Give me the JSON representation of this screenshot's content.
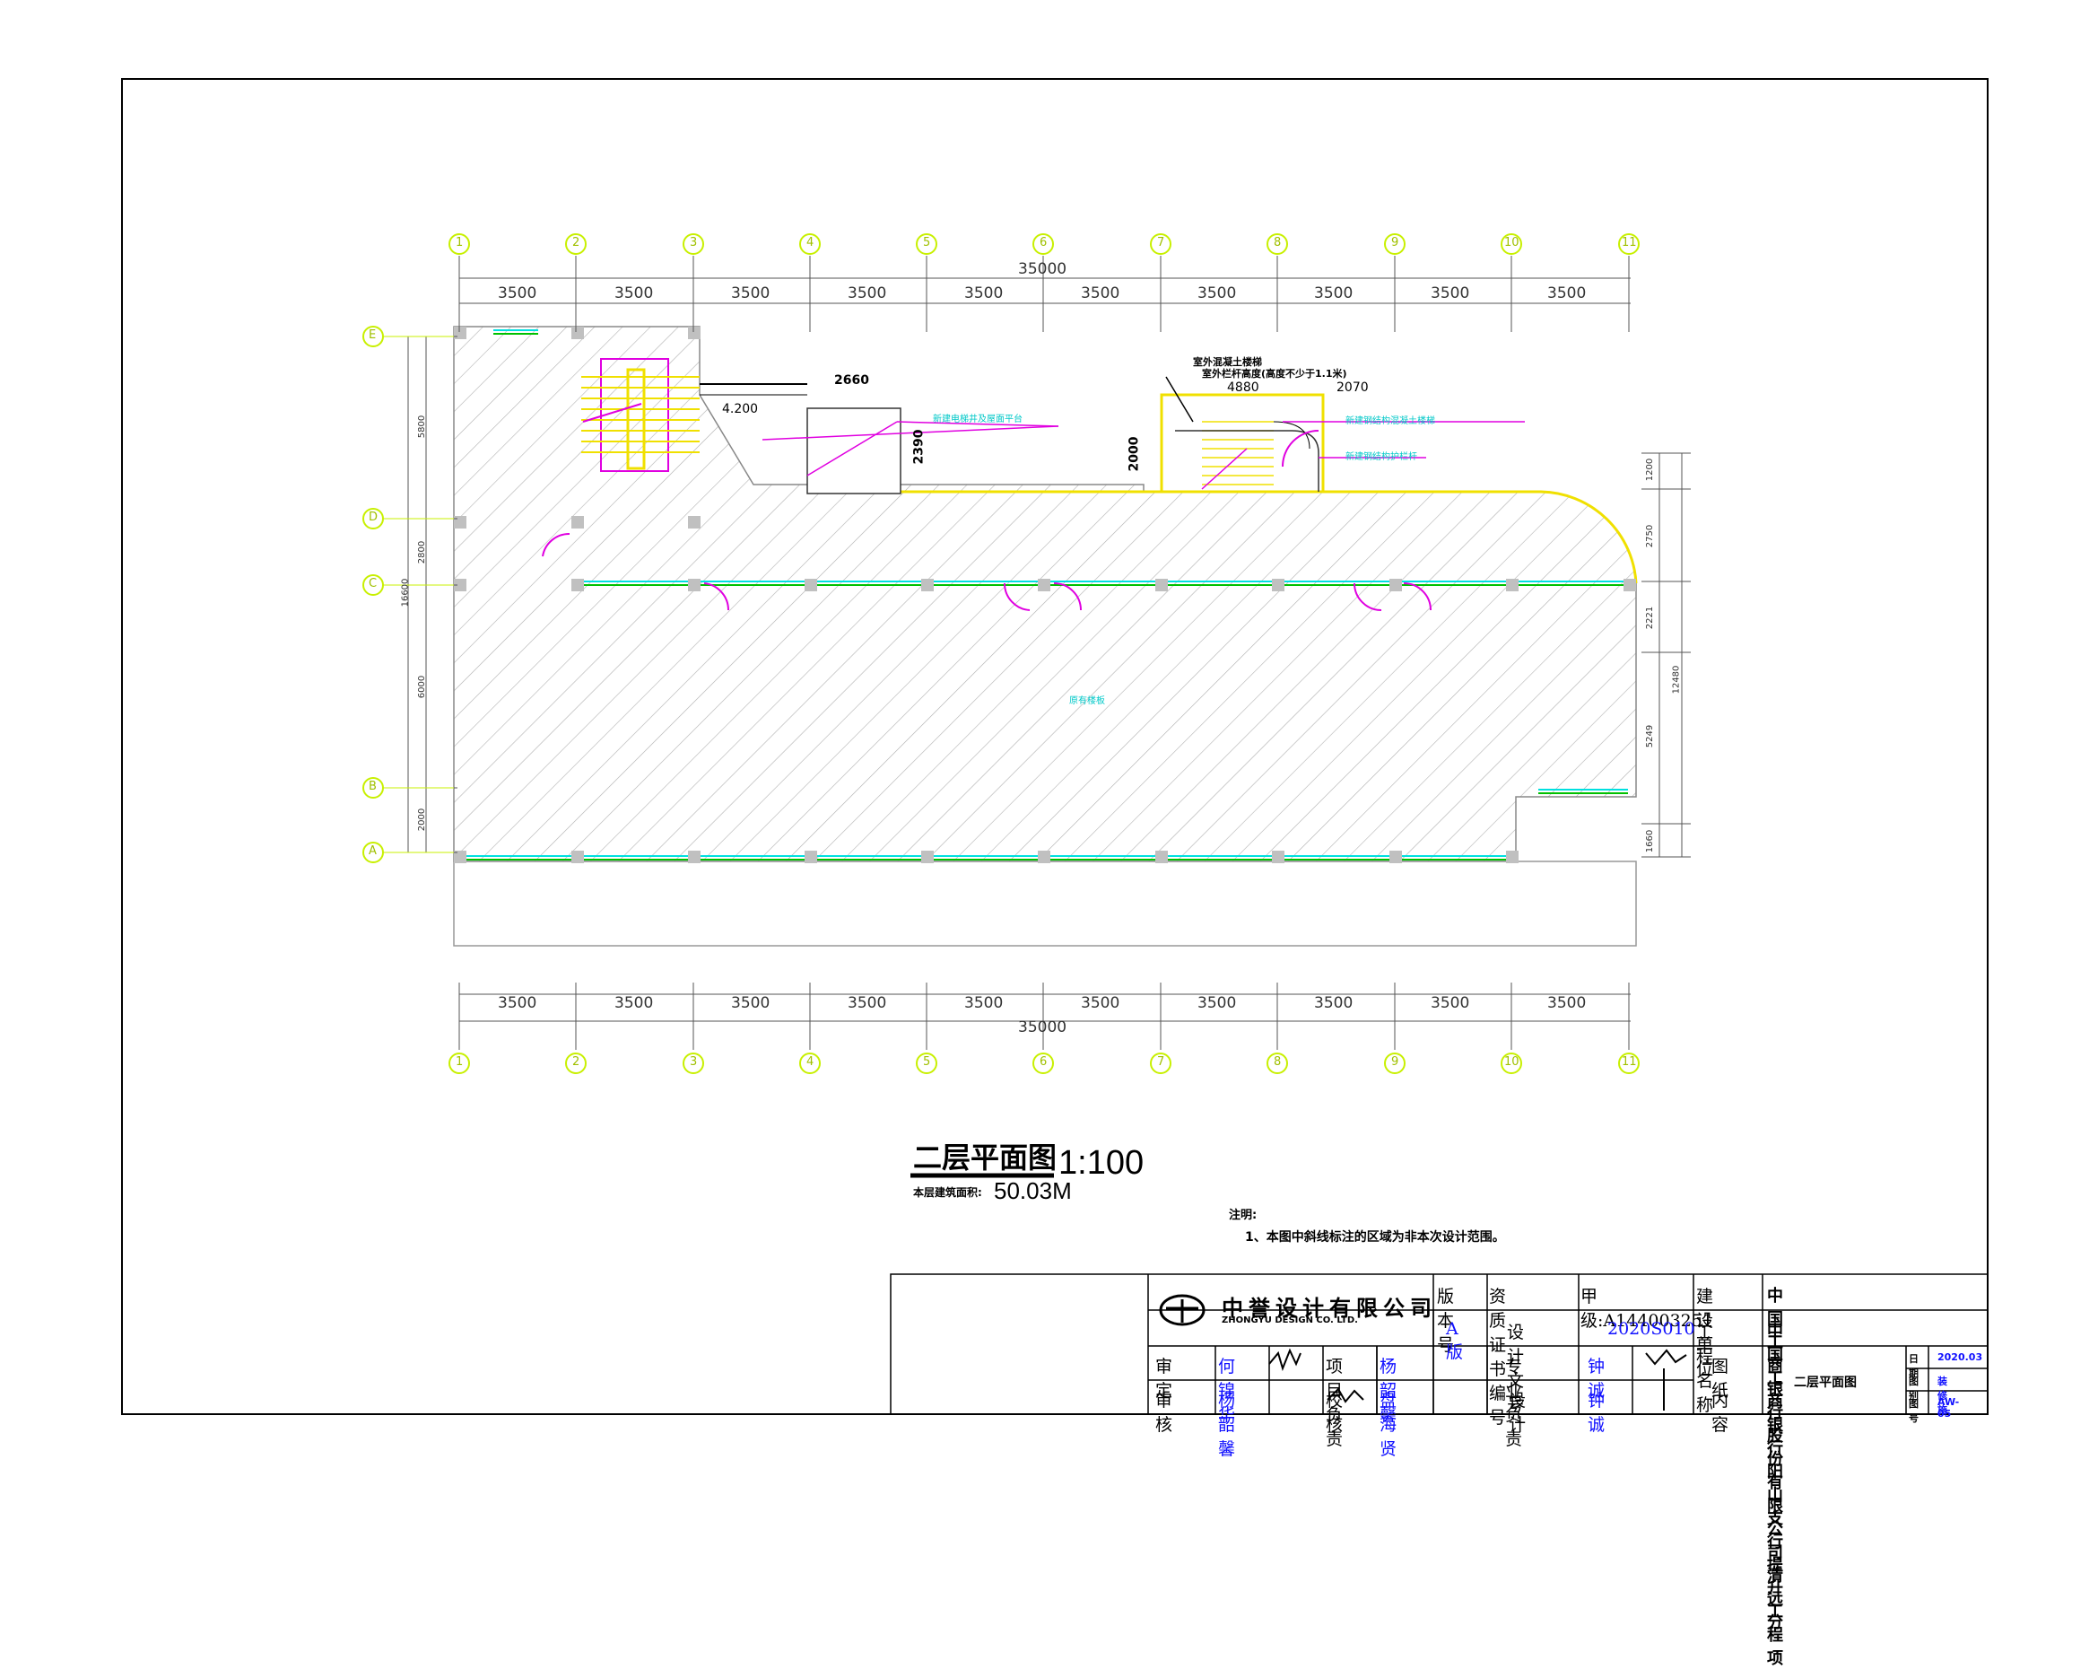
{
  "drawing": {
    "title": "二层平面图",
    "scale": "1:100",
    "area_label": "本层建筑面积:",
    "area_value": "50.03M",
    "notes_heading": "注明:",
    "note_1": "1、本图中斜线标注的区域为非本次设计范围。"
  },
  "axes": {
    "columns": [
      "1",
      "2",
      "3",
      "4",
      "5",
      "6",
      "7",
      "8",
      "9",
      "10",
      "11"
    ],
    "rows": [
      "E",
      "D",
      "C",
      "B",
      "A"
    ],
    "bay_spacing": "3500",
    "total_width": "35000",
    "left_dims": [
      "5800",
      "2800",
      "6000",
      "2000"
    ],
    "left_total": "16600",
    "right_dims": [
      "1200",
      "2750",
      "2221",
      "5249",
      "1660"
    ],
    "right_total": "12480"
  },
  "annotations": {
    "elevation": "4.200",
    "dim_2660": "2660",
    "dim_2390": "2390",
    "dim_2000": "2000",
    "dim_4880": "4880",
    "dim_2070": "2070",
    "label_elevator": "新建电梯井及屋面平台",
    "label_stair_title": "室外混凝土楼梯",
    "label_stair_note": "室外栏杆高度(高度不少于1.1米)",
    "label_new_stair": "新建钢结构混凝土楼梯",
    "label_rail": "新建钢结构护栏杆",
    "label_corridor": "原有楼板"
  },
  "title_block": {
    "company_cn": "中誉设计有限公司",
    "company_en": "ZHONGYU DESIGN CO. LTD.",
    "version_label": "版本号",
    "version_value": "A版",
    "cert_label": "资质证书编号",
    "cert_value": "甲级:A144003251",
    "doc_label": "设计文号",
    "doc_value": "2020S010",
    "client_label": "建设单位",
    "client_value": "中国工商银行股份有限公司清远分",
    "project_label": "工程名称",
    "project_value": "中国工商银行阳山支行提升工程项",
    "drawing_label_1": "图 纸",
    "drawing_label_2": "内 容",
    "drawing_value": "二层平面图",
    "r1c1": "审 定",
    "r1c2": "何锦华",
    "r1c3": "项目负责",
    "r1c4": "杨韶馨",
    "r1c5": "专业负责",
    "r1c6": "钟 诚",
    "r2c1": "审 核",
    "r2c2": "杨韶馨",
    "r2c3": "校 核",
    "r2c4": "盘海贤",
    "r2c5": "设 计",
    "r2c6": "钟 诚",
    "date_label": "日期",
    "date_value": "2020.03",
    "category_label": "图别",
    "category_value": "装修施",
    "number_label": "图号",
    "number_value": "AW-05"
  },
  "colors": {
    "axis": "#c8f000",
    "wall_yellow": "#f0e000",
    "window_cyan": "#00e0e0",
    "window_green": "#00c000",
    "magenta": "#e000e0",
    "blue_text": "#1010ff",
    "hatch": "#b8b8b8"
  }
}
